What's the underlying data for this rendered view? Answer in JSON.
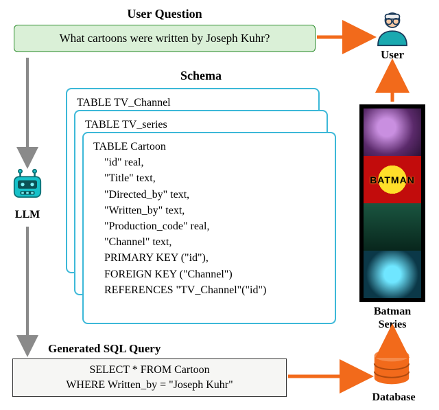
{
  "headings": {
    "user_question": "User Question",
    "schema": "Schema",
    "generated_sql": "Generated SQL Query"
  },
  "question": "What cartoons were written by Joseph Kuhr?",
  "schema_cards": {
    "card1_title": "TABLE TV_Channel",
    "card2_title": "TABLE TV_series",
    "card3": {
      "title": "TABLE Cartoon",
      "cols": [
        "\"id\" real,",
        "\"Title\" text,",
        "\"Directed_by\" text,",
        "\"Written_by\" text,",
        "\"Production_code\" real,",
        "\"Channel\" text,",
        "PRIMARY KEY (\"id\"),",
        "FOREIGN KEY (\"Channel\")",
        "REFERENCES \"TV_Channel\"(\"id\")"
      ]
    }
  },
  "sql": {
    "line1": "SELECT * FROM Cartoon",
    "line2": "WHERE Written_by = \"Joseph Kuhr\""
  },
  "labels": {
    "llm": "LLM",
    "user": "User",
    "database": "Database",
    "results_title": "Batman",
    "results_subtitle": "Series",
    "batman_text": "BATMAN"
  },
  "icons": {
    "llm": "robot-icon",
    "user": "person-icon",
    "database": "database-icon"
  }
}
